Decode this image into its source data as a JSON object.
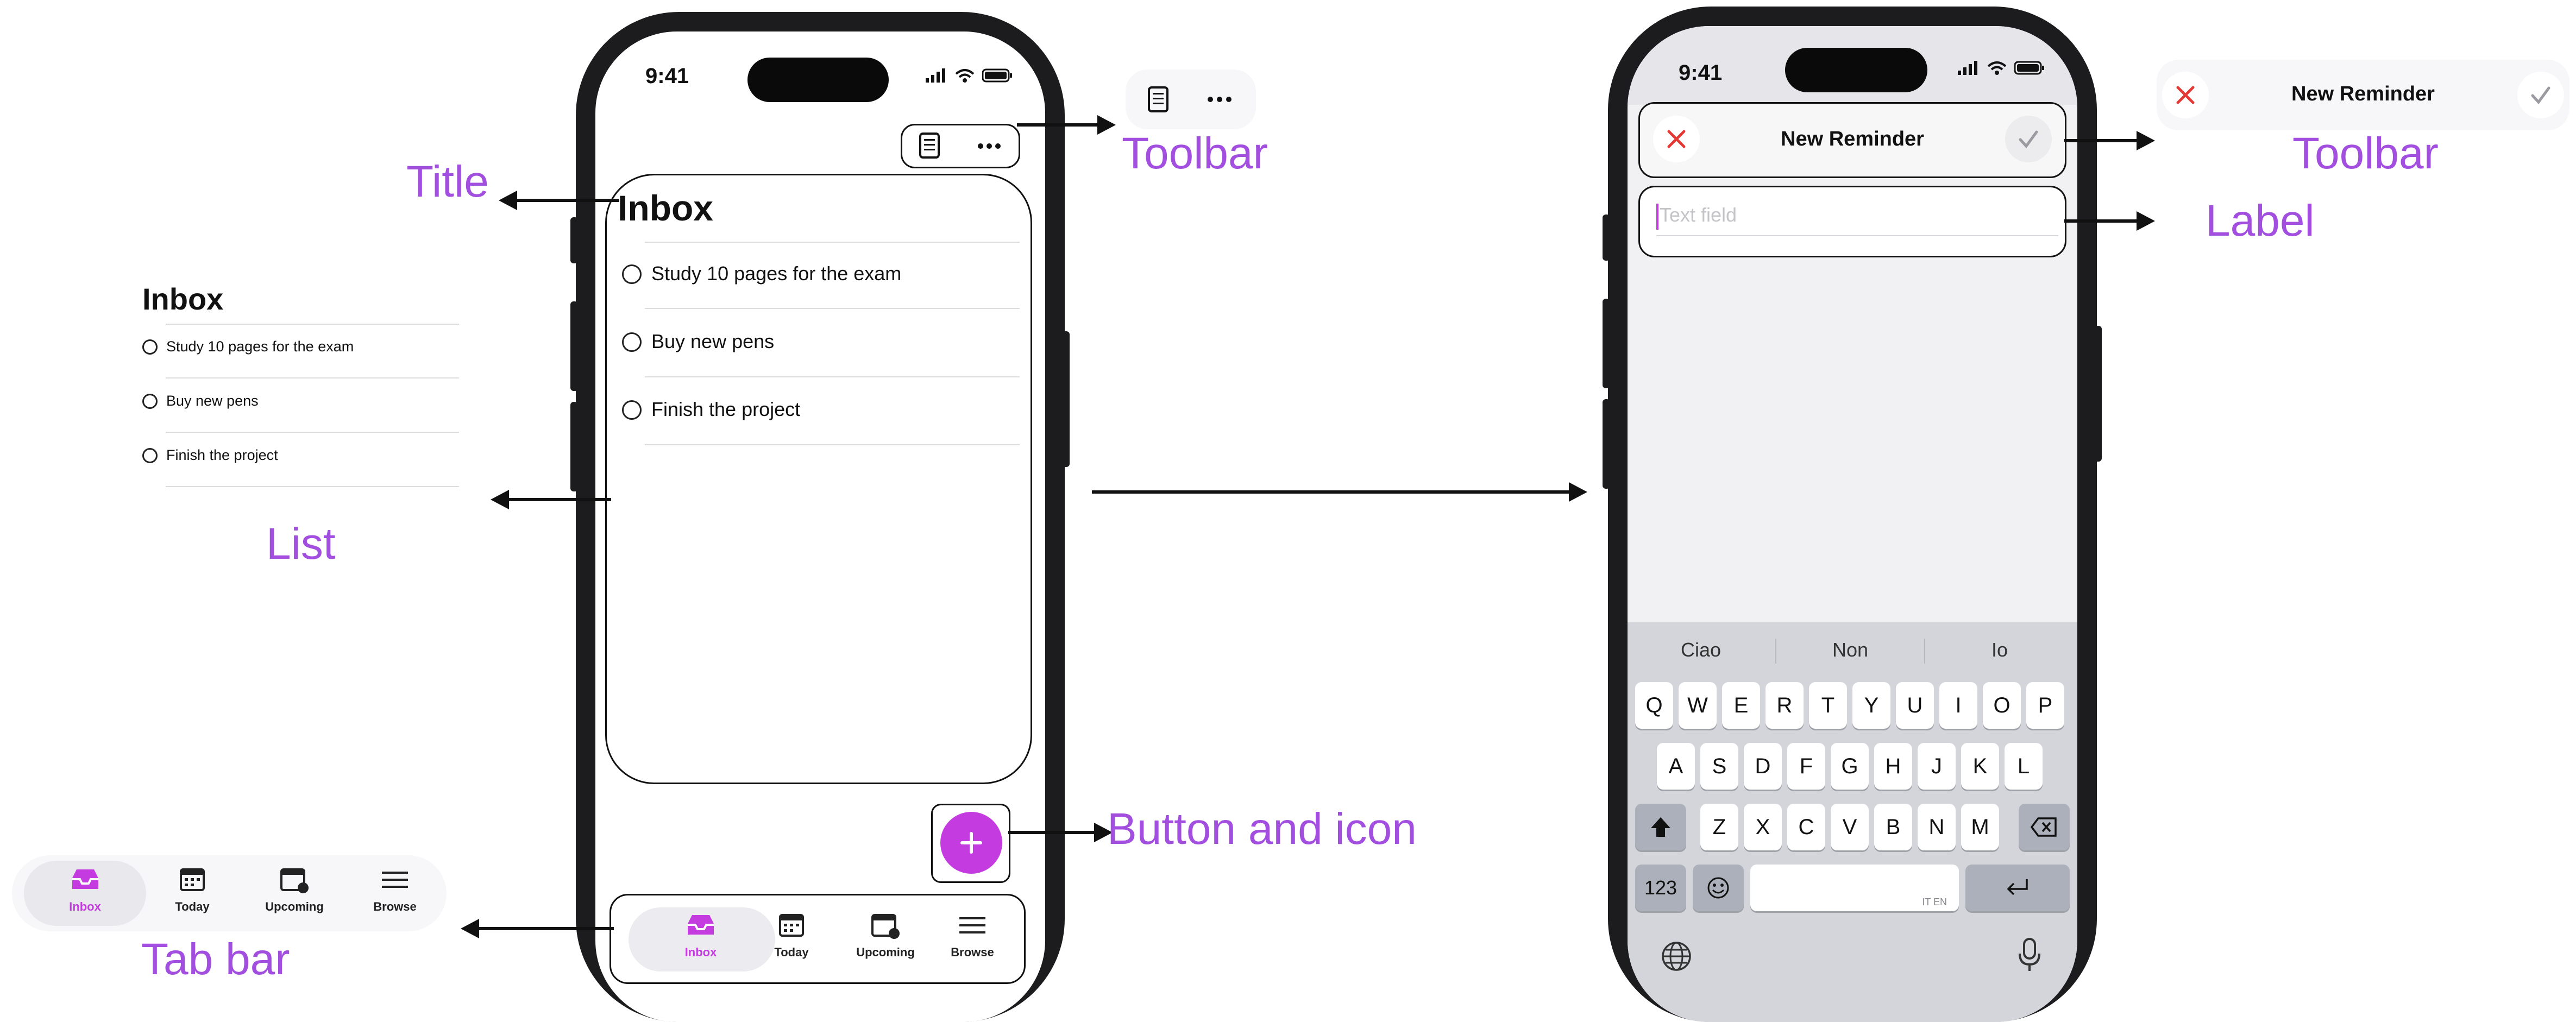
{
  "callouts": {
    "title": "Title",
    "list": "List",
    "toolbar_left": "Toolbar",
    "button_icon": "Button and icon",
    "tab_bar": "Tab bar",
    "toolbar_right": "Toolbar",
    "label": "Label"
  },
  "phone_left": {
    "time": "9:41",
    "title": "Inbox",
    "items": [
      "Study 10 pages for the exam",
      "Buy new pens",
      "Finish the project"
    ],
    "tabs": [
      "Inbox",
      "Today",
      "Upcoming",
      "Browse"
    ],
    "selected_tab": "Inbox"
  },
  "inset_list": {
    "title": "Inbox",
    "items": [
      "Study 10 pages for the exam",
      "Buy new pens",
      "Finish the project"
    ]
  },
  "inset_tabbar": {
    "tabs": [
      "Inbox",
      "Today",
      "Upcoming",
      "Browse"
    ]
  },
  "phone_right": {
    "time": "9:41",
    "toolbar_title": "New Reminder",
    "field_placeholder": "Text field",
    "predictions": [
      "Ciao",
      "Non",
      "Io"
    ],
    "row1": [
      "Q",
      "W",
      "E",
      "R",
      "T",
      "Y",
      "U",
      "I",
      "O",
      "P"
    ],
    "row2": [
      "A",
      "S",
      "D",
      "F",
      "G",
      "H",
      "J",
      "K",
      "L"
    ],
    "row3": [
      "Z",
      "X",
      "C",
      "V",
      "B",
      "N",
      "M"
    ],
    "numbers_key": "123",
    "space_hint": "IT EN"
  },
  "inset_toolbar_right": {
    "title": "New Reminder"
  },
  "colors": {
    "accent": "#c43be0",
    "callout": "#a24fe0",
    "close_red": "#e53935"
  }
}
